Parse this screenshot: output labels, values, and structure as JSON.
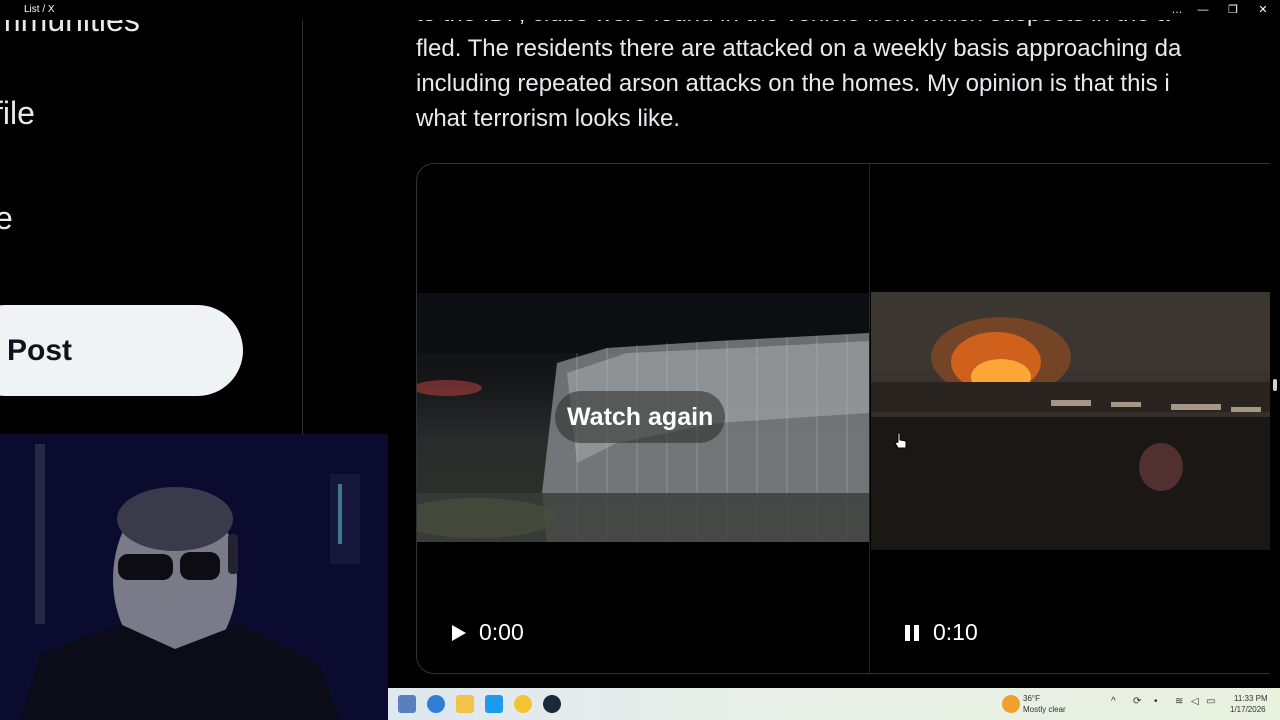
{
  "window": {
    "title": "List / X",
    "controls": [
      "…",
      "—",
      "❐",
      "✕"
    ]
  },
  "sidebar": {
    "items": [
      {
        "label": "mmunities"
      },
      {
        "label": "file"
      },
      {
        "label": "e"
      }
    ],
    "post_label": "Post"
  },
  "tweet": {
    "lines": [
      "to the IDF, clubs were found in the vehicle from which suspects in the a",
      "fled. The residents there are attacked on a weekly basis approaching da",
      "including repeated arson attacks on the homes. My opinion is that this i",
      "what terrorism looks like."
    ],
    "media": [
      {
        "overlay_label": "Watch again",
        "time": "0:00",
        "state": "play"
      },
      {
        "time": "0:10",
        "state": "pause"
      }
    ]
  },
  "taskbar": {
    "weather_temp": "36°F",
    "weather_desc": "Mostly clear",
    "time": "11:33 PM",
    "date": "1/17/2026"
  }
}
